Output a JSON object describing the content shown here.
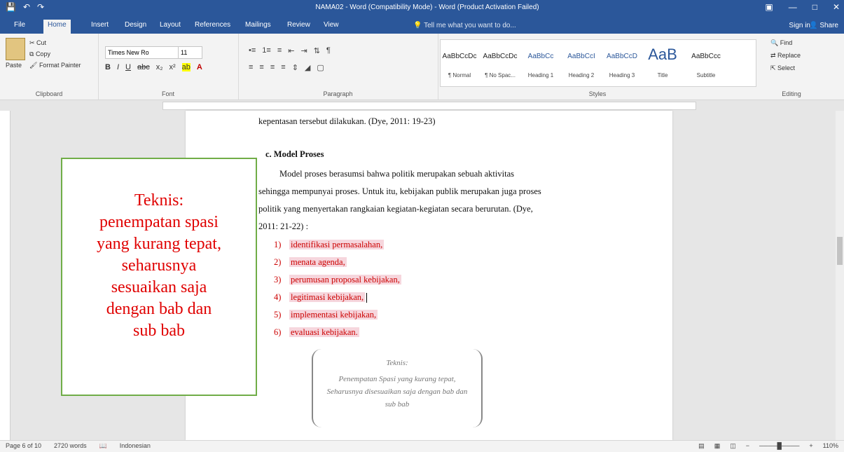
{
  "window": {
    "title": "NAMA02 - Word (Compatibility Mode) - Word (Product Activation Failed)",
    "quick_access": [
      "save-icon",
      "undo-icon",
      "redo-icon"
    ]
  },
  "tabs": [
    "File",
    "Home",
    "Insert",
    "Design",
    "Layout",
    "References",
    "Mailings",
    "Review",
    "View"
  ],
  "active_tab": "Home",
  "tell_me": "Tell me what you want to do...",
  "sign_in": "Sign in",
  "share": "Share",
  "ribbon": {
    "clipboard": {
      "label": "Clipboard",
      "paste": "Paste",
      "cut": "Cut",
      "copy": "Copy",
      "format_painter": "Format Painter"
    },
    "font": {
      "label": "Font",
      "font_name": "Times New Ro",
      "font_size": "11"
    },
    "paragraph": {
      "label": "Paragraph"
    },
    "styles": {
      "label": "Styles",
      "items": [
        {
          "preview": "AaBbCcDc",
          "name": "¶ Normal"
        },
        {
          "preview": "AaBbCcDc",
          "name": "¶ No Spac..."
        },
        {
          "preview": "AaBbCc",
          "name": "Heading 1"
        },
        {
          "preview": "AaBbCcI",
          "name": "Heading 2"
        },
        {
          "preview": "AaBbCcD",
          "name": "Heading 3"
        },
        {
          "preview": "AaB",
          "name": "Title"
        },
        {
          "preview": "AaBbCcc",
          "name": "Subtitle"
        }
      ]
    },
    "editing": {
      "label": "Editing",
      "find": "Find",
      "replace": "Replace",
      "select": "Select"
    }
  },
  "document": {
    "line_top": "kepentasan tersebut dilakukan. (Dye, 2011: 19-23)",
    "heading": "c.   Model Proses",
    "para_lines": [
      "Model proses berasumsi bahwa politik merupakan sebuah aktivitas",
      "sehingga mempunyai proses. Untuk itu, kebijakan publik merupakan juga proses",
      "politik yang menyertakan rangkaian kegiatan-kegiatan secara berurutan. (Dye,",
      "2011: 21-22) :"
    ],
    "list": [
      {
        "num": "1)",
        "text": "identifikasi permasalahan,"
      },
      {
        "num": "2)",
        "text": "menata agenda,"
      },
      {
        "num": "3)",
        "text": "perumusan proposal kebijakan,"
      },
      {
        "num": "4)",
        "text": "legitimasi kebijakan,"
      },
      {
        "num": "5)",
        "text": "implementasi kebijakan,"
      },
      {
        "num": "6)",
        "text": "evaluasi kebijakan."
      }
    ],
    "bracket_note": {
      "head": "Teknis:",
      "body": "Penempatan Spasi yang kurang tepat, Seharusnya disesuaikan saja dengan bab dan sub bab"
    }
  },
  "callout": {
    "text": "Teknis:\npenempatan spasi\nyang kurang tepat,\nseharusnya\nsesuaikan saja\ndengan bab dan\nsub bab"
  },
  "status": {
    "page": "Page 6 of 10",
    "words": "2720 words",
    "language": "Indonesian",
    "zoom": "110%"
  }
}
